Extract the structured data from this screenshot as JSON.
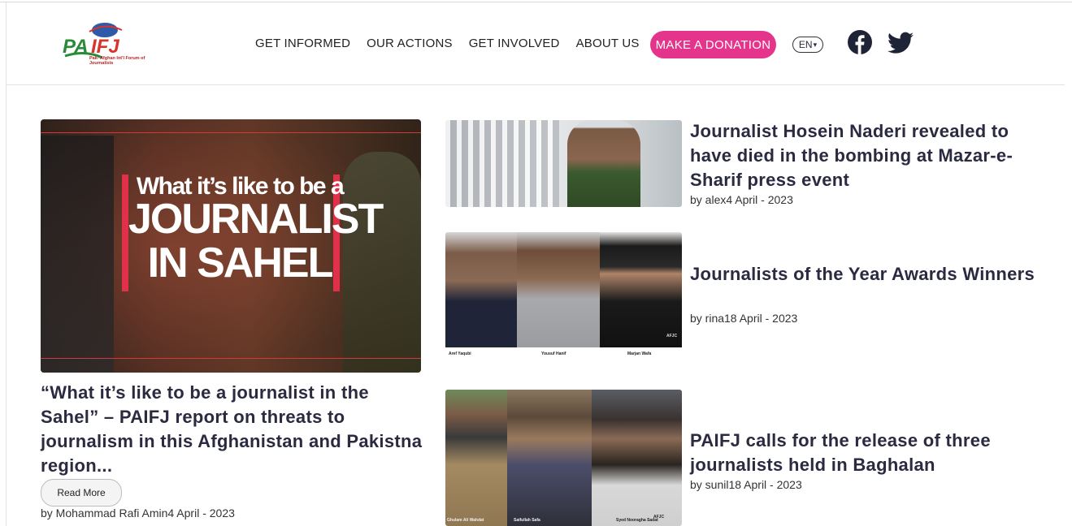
{
  "header": {
    "logo_text": "PAIFJ",
    "logo_tagline": "Pak- Afghan Int'l Forum of Journalists",
    "nav": [
      "GET INFORMED",
      "OUR ACTIONS",
      "GET INVOLVED",
      "ABOUT US"
    ],
    "donate_label": "MAKE A DONATION",
    "language": "EN",
    "social": [
      "facebook-icon",
      "twitter-icon"
    ],
    "accent_color": "#e5348c"
  },
  "featured": {
    "image_line1": "What it’s like to be a",
    "image_line2": "JOURNALIST",
    "image_line3": "IN SAHEL",
    "title": "“What it’s like to be a journalist in the Sahel” – PAIFJ report on threats to journalism in this Afghanistan and Pakistna region...",
    "read_more": "Read More",
    "byline": "by Mohammad Rafi Amin4 April - 2023"
  },
  "articles": [
    {
      "title": "Journalist Hosein Naderi revealed to have died in the bombing at Mazar-e-Sharif press event",
      "byline": "by alex4 April - 2023"
    },
    {
      "title": "Journalists of the Year Awards Winners",
      "byline": "by rina18 April - 2023",
      "captions": [
        "Aref Yaqubi",
        "Yousuf Hanif",
        "Marjan Wafa"
      ],
      "watermark": "AFJC"
    },
    {
      "title": "PAIFJ calls for the release of three journalists held in Baghalan",
      "byline": "by sunil18 April - 2023",
      "captions": [
        "Ghulam Ali Wahdat",
        "Saifullah Safa",
        "Syed Nooragha Sadat"
      ],
      "watermark": "AFJC"
    }
  ]
}
